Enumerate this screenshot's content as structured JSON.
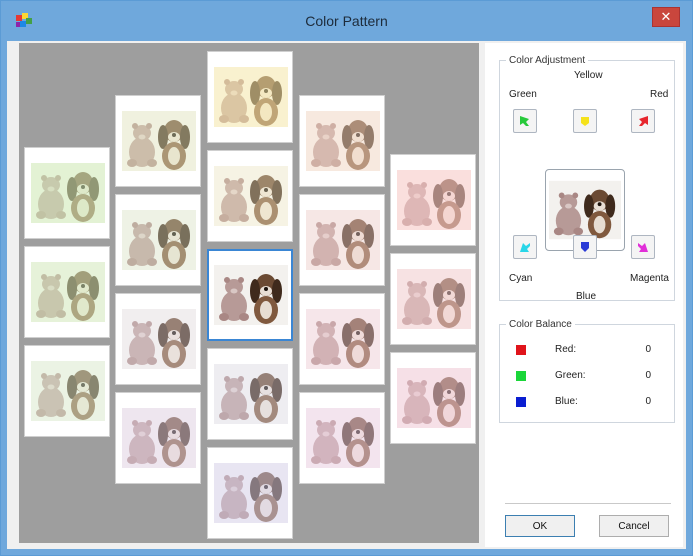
{
  "window": {
    "title": "Color Pattern",
    "close_glyph": "✕"
  },
  "thumbnails": [
    {
      "tint": "#d6f2c0",
      "opacity": 0.55
    },
    {
      "tint": "#d9f4c4",
      "opacity": 0.5
    },
    {
      "tint": "#e2f6d6",
      "opacity": 0.45
    },
    {
      "tint": "#eaf3c8",
      "opacity": 0.4
    },
    {
      "tint": "#e6f3d3",
      "opacity": 0.35
    },
    {
      "tint": "#eee8f2",
      "opacity": 0.35
    },
    {
      "tint": "#e8daf0",
      "opacity": 0.45
    },
    {
      "tint": "#fff2b0",
      "opacity": 0.5
    },
    {
      "tint": "#fbf6d0",
      "opacity": 0.35
    },
    {
      "tint": "#ffffff",
      "opacity": 0.0,
      "selected": true
    },
    {
      "tint": "#e6e6f7",
      "opacity": 0.35
    },
    {
      "tint": "#dcd8f6",
      "opacity": 0.45
    },
    {
      "tint": "#fde0cc",
      "opacity": 0.45
    },
    {
      "tint": "#fbdad8",
      "opacity": 0.4
    },
    {
      "tint": "#f9d8e4",
      "opacity": 0.4
    },
    {
      "tint": "#f4d4ee",
      "opacity": 0.45
    },
    {
      "tint": "#ffd0d0",
      "opacity": 0.55
    },
    {
      "tint": "#fcd4d8",
      "opacity": 0.5
    },
    {
      "tint": "#f9d0e0",
      "opacity": 0.5
    }
  ],
  "color_adjustment": {
    "legend": "Color Adjustment",
    "labels": {
      "yellow": "Yellow",
      "green": "Green",
      "red": "Red",
      "cyan": "Cyan",
      "magenta": "Magenta",
      "blue": "Blue"
    },
    "button_colors": {
      "green": "#27c93a",
      "yellow": "#f5e21b",
      "red": "#e7262d",
      "cyan": "#29d6e8",
      "blue": "#2a3bd6",
      "magenta": "#e12fd8"
    }
  },
  "color_balance": {
    "legend": "Color Balance",
    "rows": [
      {
        "label": "Red:",
        "value": "0",
        "color": "#e0141b"
      },
      {
        "label": "Green:",
        "value": "0",
        "color": "#1ad639"
      },
      {
        "label": "Blue:",
        "value": "0",
        "color": "#0a1ed1"
      }
    ]
  },
  "buttons": {
    "ok": "OK",
    "cancel": "Cancel"
  }
}
